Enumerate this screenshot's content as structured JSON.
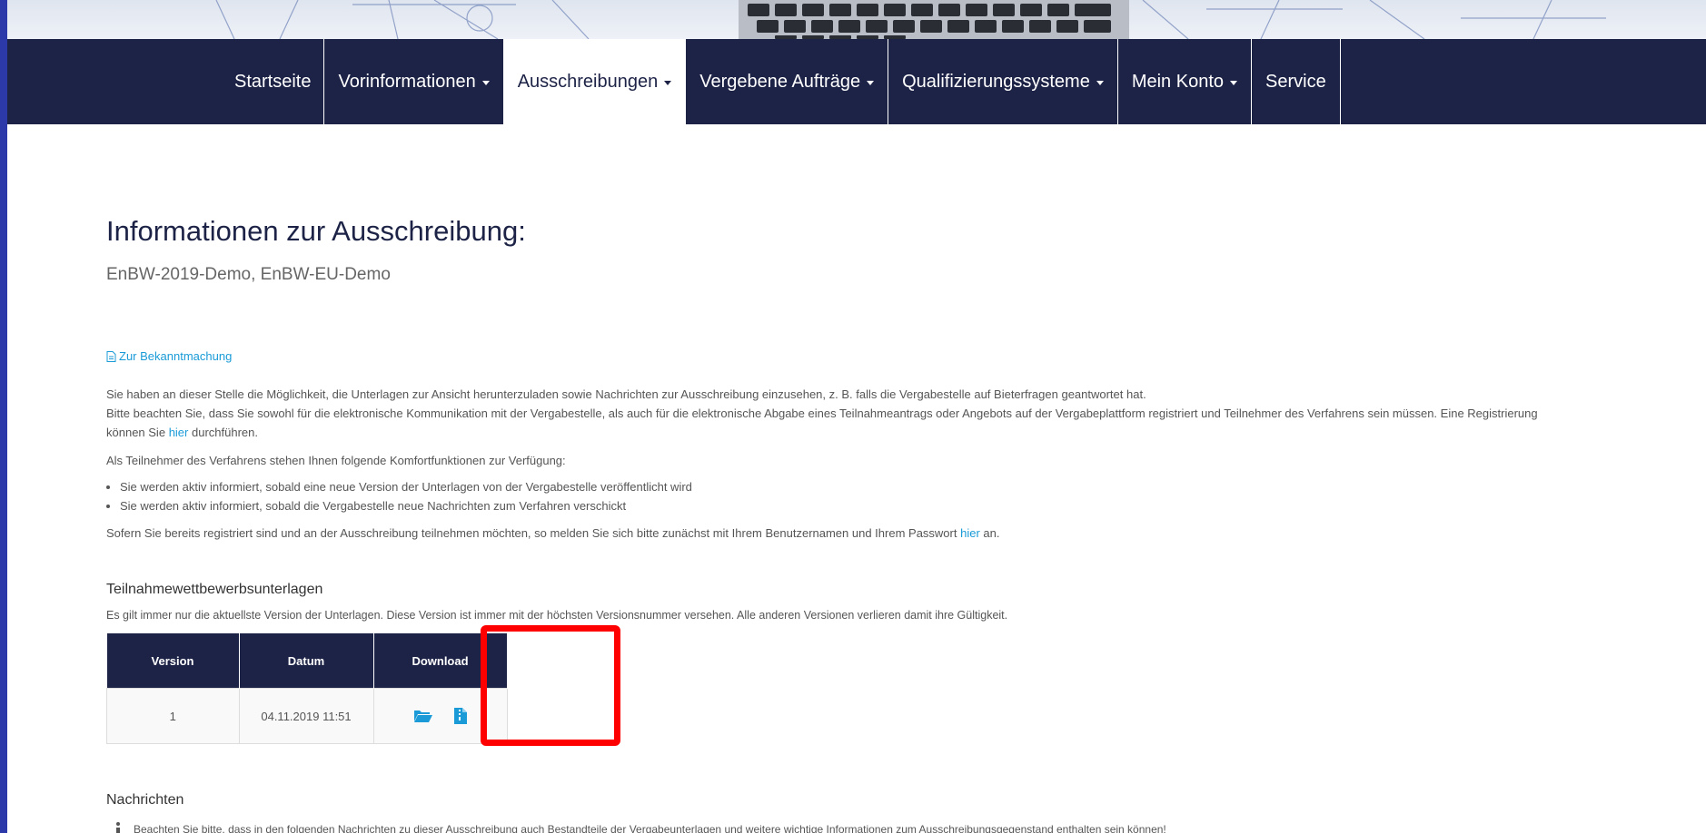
{
  "nav": {
    "items": [
      {
        "label": "Startseite",
        "dropdown": false,
        "active": false
      },
      {
        "label": "Vorinformationen",
        "dropdown": true,
        "active": false
      },
      {
        "label": "Ausschreibungen",
        "dropdown": true,
        "active": true
      },
      {
        "label": "Vergebene Aufträge",
        "dropdown": true,
        "active": false
      },
      {
        "label": "Qualifizierungssysteme",
        "dropdown": true,
        "active": false
      },
      {
        "label": "Mein Konto",
        "dropdown": true,
        "active": false
      },
      {
        "label": "Service",
        "dropdown": false,
        "active": false
      }
    ]
  },
  "page": {
    "title": "Informationen zur Ausschreibung:",
    "subtitle": "EnBW-2019-Demo, EnBW-EU-Demo",
    "bekanntmachung_link": "Zur Bekanntmachung",
    "intro_line1": "Sie haben an dieser Stelle die Möglichkeit, die Unterlagen zur Ansicht herunterzuladen sowie Nachrichten zur Ausschreibung einzusehen, z. B. falls die Vergabestelle auf Bieterfragen geantwortet hat.",
    "intro_line2": "Bitte beachten Sie, dass Sie sowohl für die elektronische Kommunikation mit der Vergabestelle, als auch für die elektronische Abgabe eines Teilnahmeantrags oder Angebots auf der Vergabeplattform registriert und Teilnehmer des Verfahrens sein müssen. Eine Registrierung können Sie",
    "intro_link1": "hier",
    "intro_line2_end": "durchführen.",
    "features_intro": "Als Teilnehmer des Verfahrens stehen Ihnen folgende Komfortfunktionen zur Verfügung:",
    "features": [
      "Sie werden aktiv informiert, sobald eine neue Version der Unterlagen von der Vergabestelle veröffentlicht wird",
      "Sie werden aktiv informiert, sobald die Vergabestelle neue Nachrichten zum Verfahren verschickt"
    ],
    "login_text": "Sofern Sie bereits registriert sind und an der Ausschreibung teilnehmen möchten, so melden Sie sich bitte zunächst mit Ihrem Benutzernamen und Ihrem Passwort",
    "login_link": "hier",
    "login_end": "an."
  },
  "documents": {
    "heading": "Teilnahmewettbewerbsunterlagen",
    "note": "Es gilt immer nur die aktuellste Version der Unterlagen. Diese Version ist immer mit der höchsten Versionsnummer versehen. Alle anderen Versionen verlieren damit ihre Gültigkeit.",
    "columns": [
      "Version",
      "Datum",
      "Download"
    ],
    "rows": [
      {
        "version": "1",
        "datum": "04.11.2019 11:51",
        "icons": [
          "folder-open-icon",
          "zip-file-icon"
        ]
      }
    ]
  },
  "messages": {
    "heading": "Nachrichten",
    "info_text": "Beachten Sie bitte, dass in den folgenden Nachrichten zu dieser Ausschreibung auch Bestandteile der Vergabeunterlagen und weitere wichtige Informationen zum Ausschreibungsgegenstand enthalten sein können!"
  },
  "colors": {
    "navbar": "#1d2346",
    "link": "#1a9bd7",
    "highlight": "#ff0000",
    "outer_border": "#2b3aa8"
  }
}
